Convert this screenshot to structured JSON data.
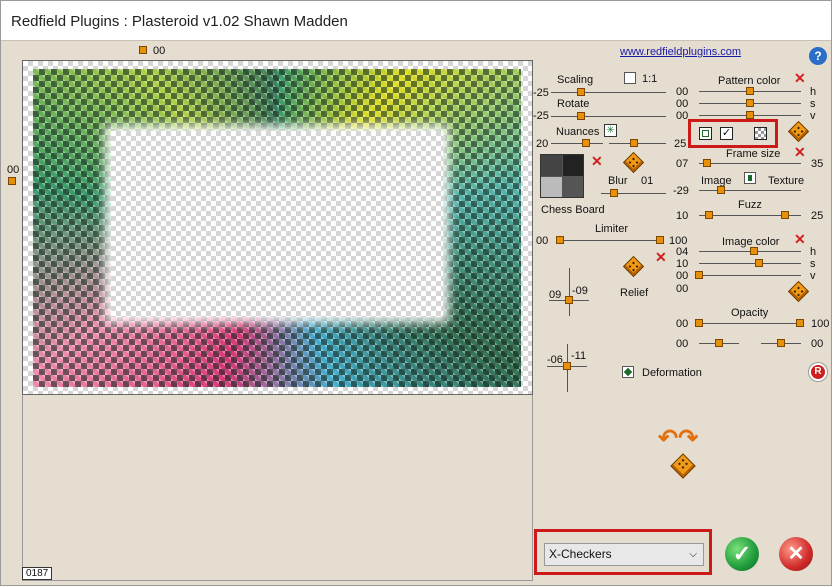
{
  "window": {
    "title": "Redfield Plugins : Plasteroid v1.02   Shawn Madden"
  },
  "preview": {
    "top_value": "00",
    "left_value": "00",
    "counter": "0187"
  },
  "link": "www.redfieldplugins.com",
  "help_icon": "?",
  "scaling": {
    "label": "Scaling",
    "value": "-25",
    "checkbox_label": "1:1"
  },
  "rotate": {
    "label": "Rotate",
    "value": "-25"
  },
  "nuances": {
    "label": "Nuances",
    "value_left": "20",
    "value_right": "25"
  },
  "chess": {
    "label": "Chess Board"
  },
  "blur": {
    "label": "Blur",
    "value": "01"
  },
  "limiter": {
    "label": "Limiter",
    "min": "00",
    "max": "100"
  },
  "relief": {
    "label": "Relief",
    "v1": "09",
    "v2": "-09"
  },
  "deformation": {
    "label": "Deformation",
    "v1": "-06",
    "v2": "-11"
  },
  "pattern_color": {
    "label": "Pattern color",
    "h": "00",
    "s": "00",
    "v": "00",
    "h_lbl": "h",
    "s_lbl": "s",
    "v_lbl": "v"
  },
  "frame_size": {
    "label": "Frame size",
    "left": "07",
    "right": "35"
  },
  "image_texture": {
    "image_label": "Image",
    "texture_label": "Texture",
    "value": "-29"
  },
  "fuzz": {
    "label": "Fuzz",
    "left": "10",
    "right": "25"
  },
  "image_color": {
    "label": "Image color",
    "h": "04",
    "s": "10",
    "v": "00",
    "extra": "00",
    "h_lbl": "h",
    "s_lbl": "s",
    "v_lbl": "v"
  },
  "opacity": {
    "label": "Opacity",
    "left": "00",
    "right": "100",
    "row2_left": "00",
    "row2_right": "00"
  },
  "preset": {
    "selected": "X-Checkers"
  },
  "reset_icon": "R",
  "colors": {
    "accent": "#e8900a",
    "highlight_red": "#cc1a1a",
    "ok": "#2aa84a",
    "cancel": "#d42a2a"
  }
}
